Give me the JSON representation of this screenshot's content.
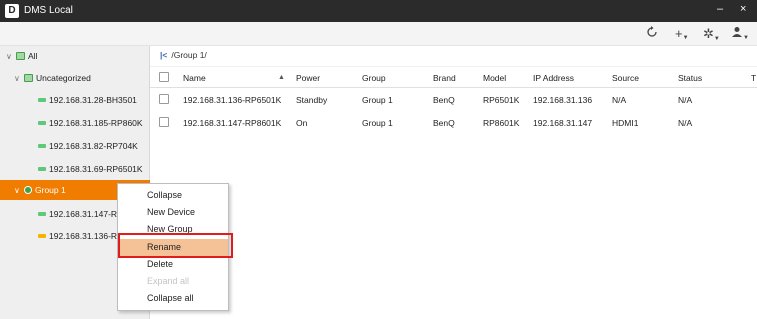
{
  "window": {
    "icon_letter": "D",
    "title": "DMS Local",
    "minimize": "–",
    "close": "×"
  },
  "toolbar": {
    "refresh_icon": "refresh-icon",
    "add_label": "+",
    "settings_glyph": "✲",
    "user_glyph": "👤"
  },
  "sidebar": {
    "all_label": "All",
    "uncategorized_label": "Uncategorized",
    "uncat_devices": [
      "192.168.31.28-BH3501",
      "192.168.31.185-RP860K",
      "192.168.31.82-RP704K",
      "192.168.31.69-RP6501K"
    ],
    "group_label": "Group 1",
    "group_devices": [
      "192.168.31.147-RP8",
      "192.168.31.136-RP6"
    ]
  },
  "main": {
    "breadcrumb_back": "|<",
    "breadcrumb_path": "/Group 1/",
    "columns": [
      "Name",
      "Power",
      "Group",
      "Brand",
      "Model",
      "IP Address",
      "Source",
      "Status",
      "T"
    ],
    "rows": [
      [
        "192.168.31.136-RP6501K",
        "Standby",
        "Group 1",
        "BenQ",
        "RP6501K",
        "192.168.31.136",
        "N/A",
        "N/A"
      ],
      [
        "192.168.31.147-RP8601K",
        "On",
        "Group 1",
        "BenQ",
        "RP8601K",
        "192.168.31.147",
        "HDMI1",
        "N/A"
      ]
    ]
  },
  "context_menu": {
    "items": [
      {
        "label": "Collapse",
        "enabled": true
      },
      {
        "label": "New Device",
        "enabled": true
      },
      {
        "label": "New Group",
        "enabled": true
      },
      {
        "label": "Rename",
        "enabled": true,
        "highlighted": true
      },
      {
        "label": "Delete",
        "enabled": true
      },
      {
        "label": "Expand all",
        "enabled": false
      },
      {
        "label": "Collapse all",
        "enabled": true
      }
    ]
  },
  "colors": {
    "selected_group": "#f07c00",
    "highlight": "#f5c298",
    "annotation_box": "#e21b1b"
  }
}
